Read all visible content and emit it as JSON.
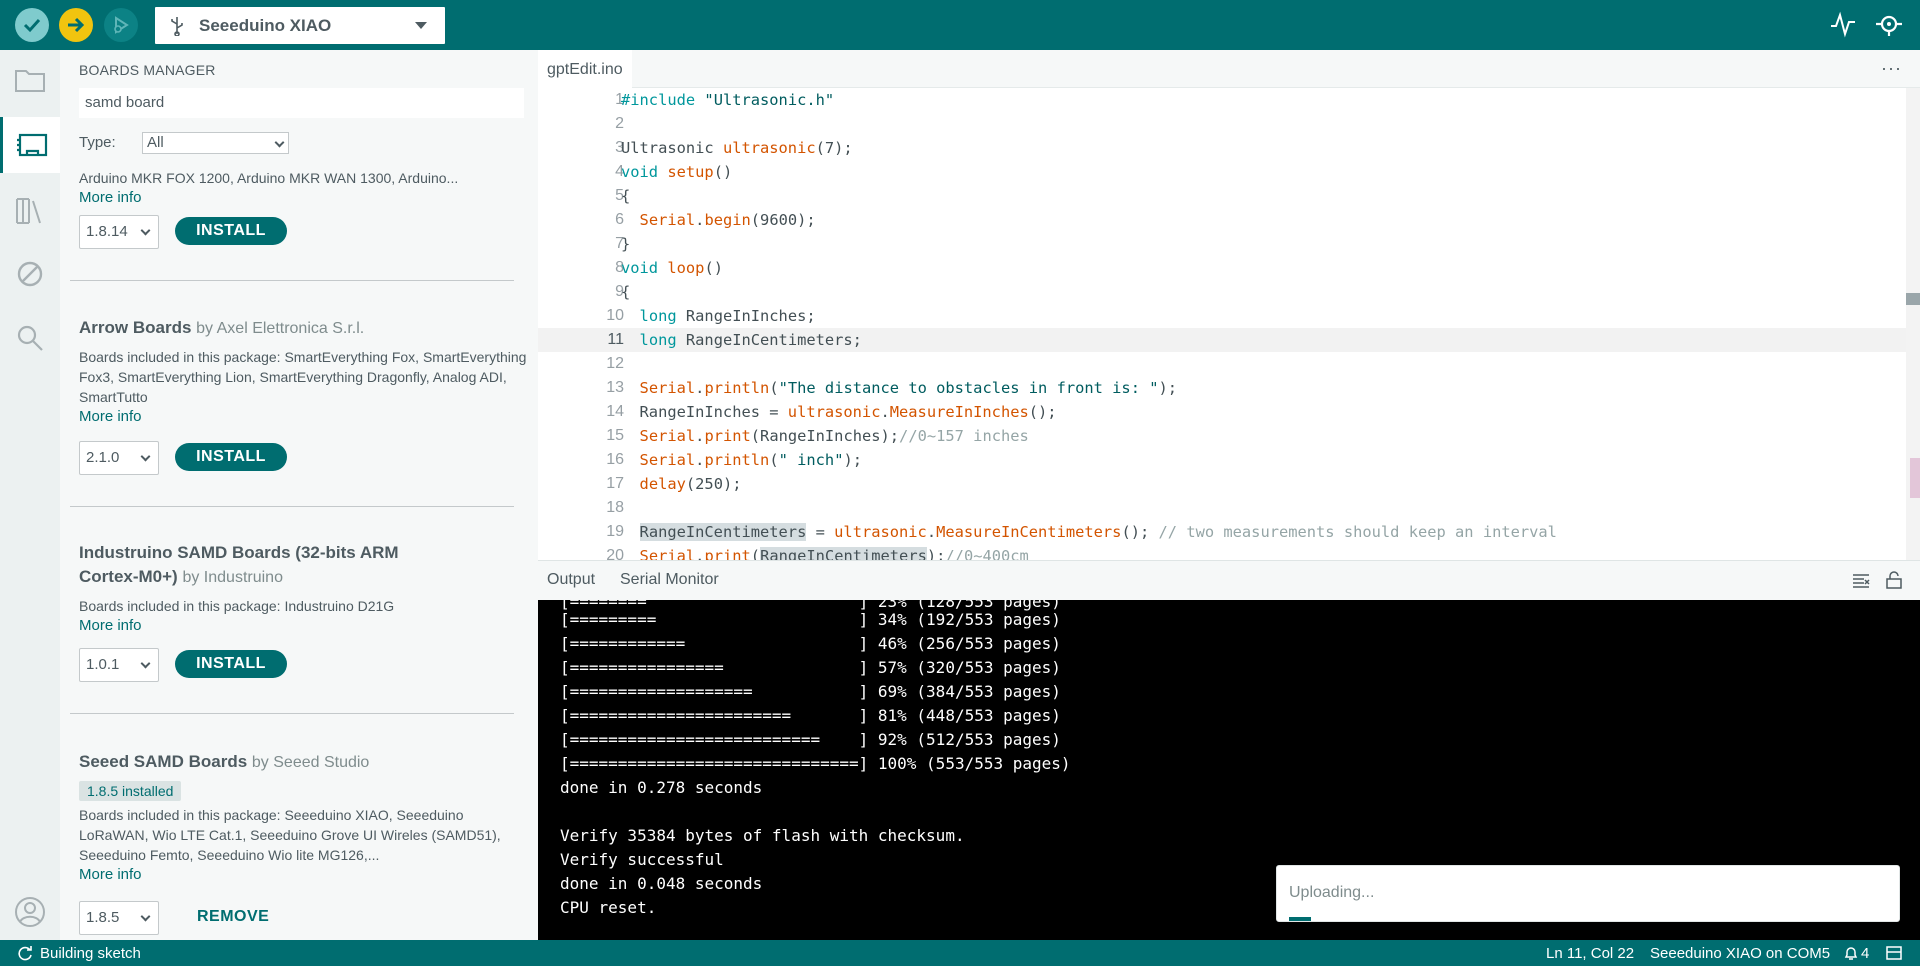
{
  "toolbar": {
    "board_name": "Seeeduino XIAO",
    "verify_icon": "check-icon",
    "upload_icon": "arrow-right-icon",
    "debug_icon": "debug-play-icon",
    "colors": {
      "bar": "#006d70",
      "verify": "#7fcbcd",
      "upload": "#f1c40f"
    }
  },
  "sidebar": {
    "title": "BOARDS MANAGER",
    "search_value": "samd board",
    "type_label": "Type:",
    "type_value": "All",
    "packages": [
      {
        "title": "",
        "author": "",
        "description": "Arduino MKR FOX 1200, Arduino MKR WAN 1300, Arduino...",
        "more_info": "More info",
        "version": "1.8.14",
        "action": "INSTALL"
      },
      {
        "title": "Arrow Boards",
        "author": "by Axel Elettronica S.r.l.",
        "description": "Boards included in this package: SmartEverything Fox, SmartEverything Fox3, SmartEverything Lion, SmartEverything Dragonfly, Analog ADI, SmartTutto",
        "more_info": "More info",
        "version": "2.1.0",
        "action": "INSTALL"
      },
      {
        "title": "Industruino SAMD Boards (32-bits ARM Cortex-M0+)",
        "author": "by Industruino",
        "description": "Boards included in this package: Industruino D21G",
        "more_info": "More info",
        "version": "1.0.1",
        "action": "INSTALL"
      },
      {
        "title": "Seeed SAMD Boards",
        "author": "by Seeed Studio",
        "installed": "1.8.5 installed",
        "description": "Boards included in this package: Seeeduino XIAO, Seeeduino LoRaWAN, Wio LTE Cat.1, Seeeduino Grove UI Wireles (SAMD51), Seeeduino Femto, Seeeduino Wio lite MG126,...",
        "more_info": "More info",
        "version": "1.8.5",
        "action": "REMOVE"
      }
    ]
  },
  "editor": {
    "tab": "gptEdit.ino",
    "current_line": 11,
    "line_numbers": [
      "1",
      "2",
      "3",
      "4",
      "5",
      "6",
      "7",
      "8",
      "9",
      "10",
      "11",
      "12",
      "13",
      "14",
      "15",
      "16",
      "17",
      "18",
      "19",
      "20"
    ]
  },
  "output_panel": {
    "tabs": [
      "Output",
      "Serial Monitor"
    ],
    "lines": [
      "[=========                     ] 34% (192/553 pages)",
      "[============                  ] 46% (256/553 pages)",
      "[================              ] 57% (320/553 pages)",
      "[===================           ] 69% (384/553 pages)",
      "[=======================       ] 81% (448/553 pages)",
      "[==========================    ] 92% (512/553 pages)",
      "[==============================] 100% (553/553 pages)",
      "done in 0.278 seconds",
      "",
      "Verify 35384 bytes of flash with checksum.",
      "Verify successful",
      "done in 0.048 seconds",
      "CPU reset."
    ]
  },
  "toast": {
    "message": "Uploading..."
  },
  "statusbar": {
    "left": "Building sketch",
    "position": "Ln 11, Col 22",
    "board": "Seeeduino XIAO on COM5",
    "notifications": "4"
  }
}
